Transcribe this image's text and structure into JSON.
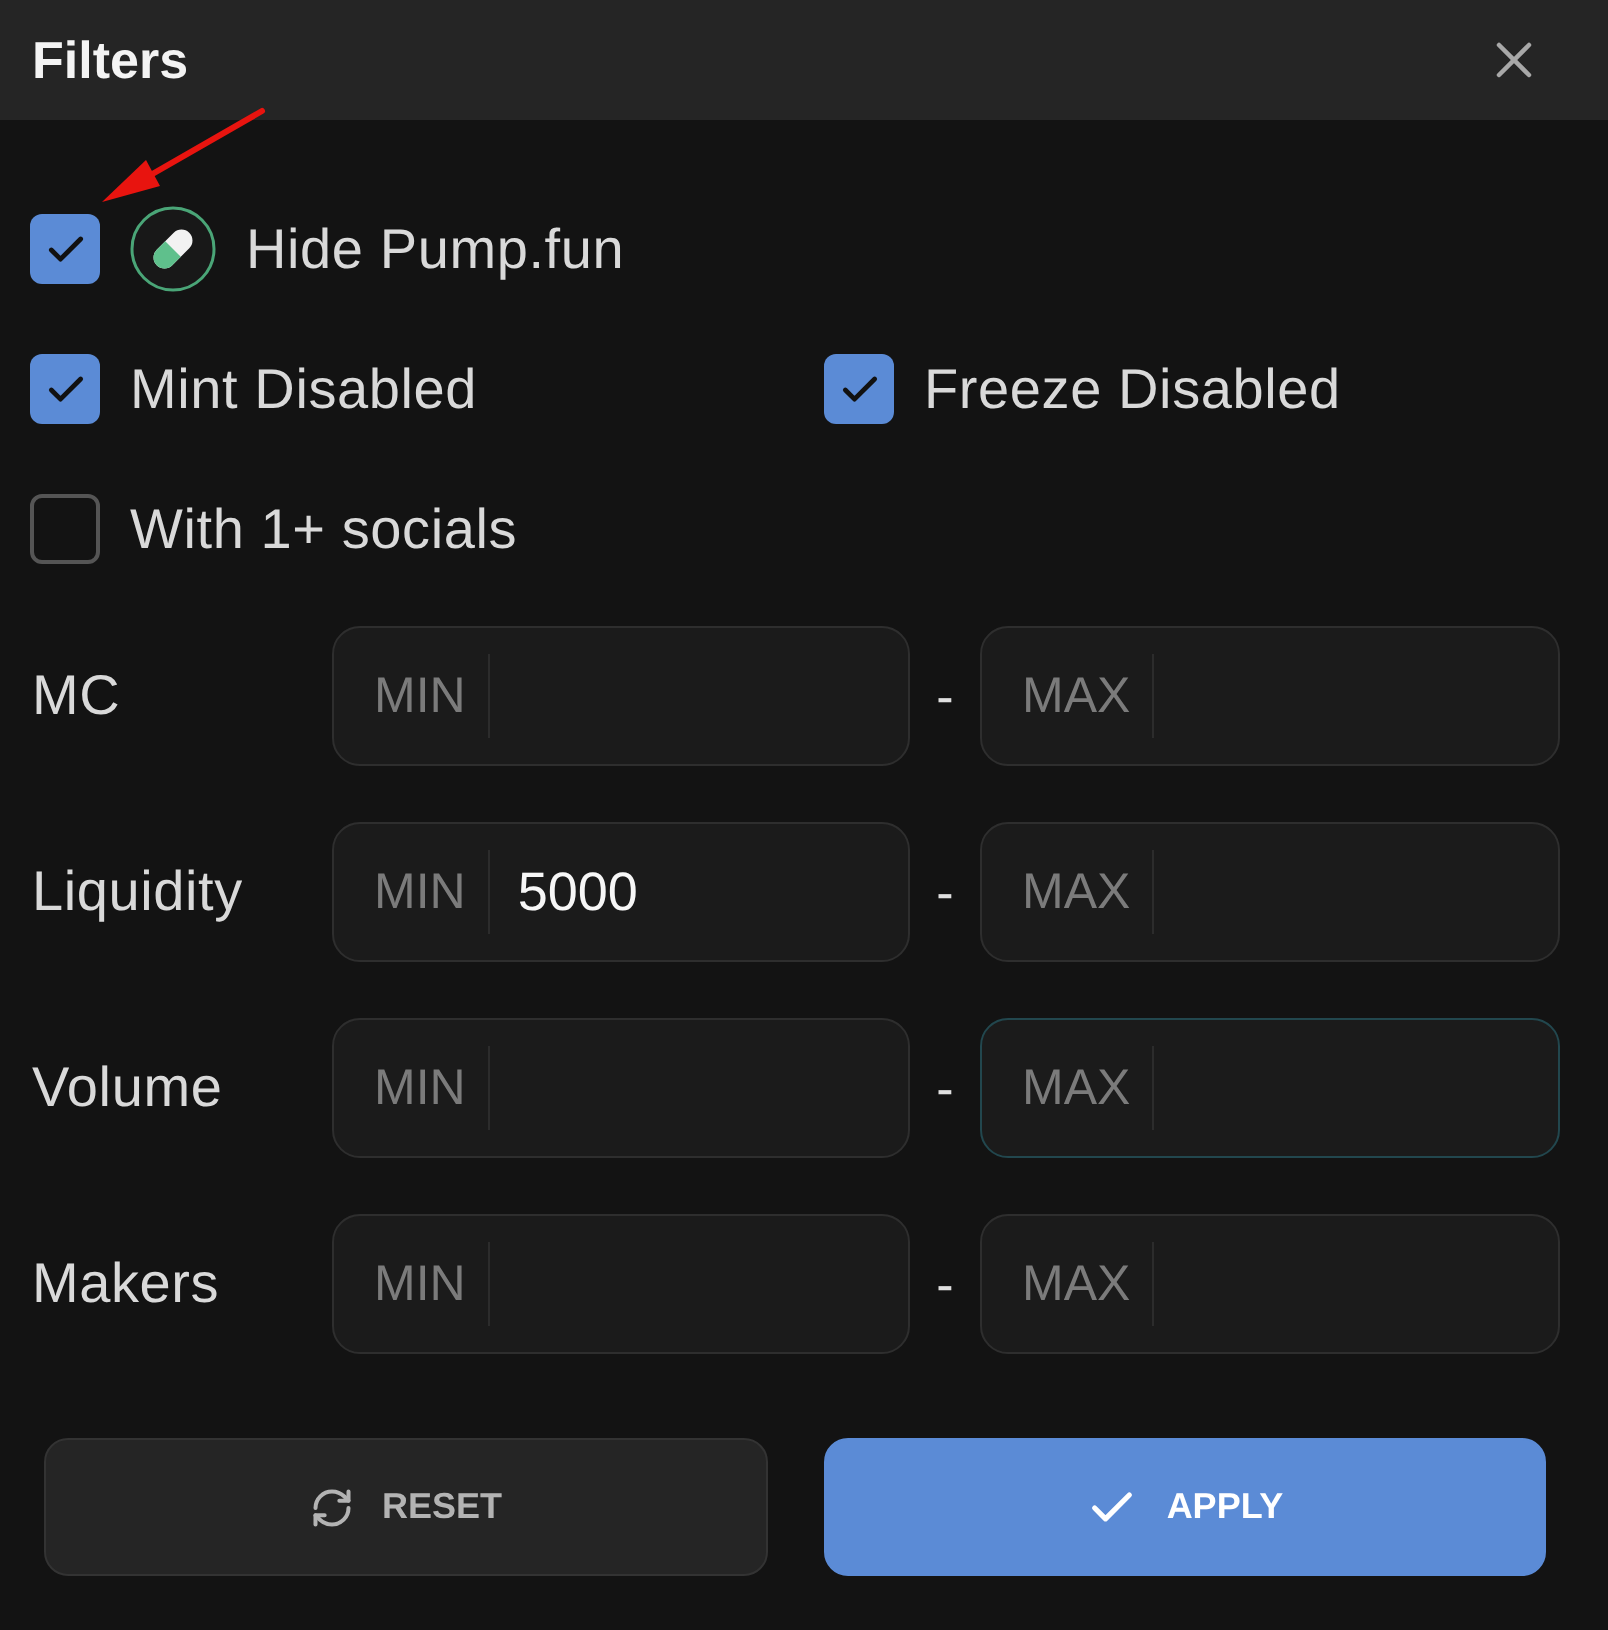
{
  "header": {
    "title": "Filters"
  },
  "checkbox_rows": [
    {
      "items": [
        {
          "kind": "badged",
          "label": "Hide Pump.fun",
          "checked": true
        }
      ]
    },
    {
      "items": [
        {
          "kind": "plain",
          "label": "Mint Disabled",
          "checked": true
        },
        {
          "kind": "plain",
          "label": "Freeze Disabled",
          "checked": true
        }
      ]
    },
    {
      "items": [
        {
          "kind": "plain",
          "label": "With 1+ socials",
          "checked": false
        }
      ]
    }
  ],
  "ranges": [
    {
      "label": "MC",
      "min": {
        "prefix": "MIN",
        "focused": false
      },
      "separator": "-",
      "max": {
        "prefix": "MAX",
        "focused": false
      }
    },
    {
      "label": "Liquidity",
      "min": {
        "prefix": "MIN",
        "value": "5000",
        "focused": false
      },
      "separator": "-",
      "max": {
        "prefix": "MAX",
        "focused": false
      }
    },
    {
      "label": "Volume",
      "min": {
        "prefix": "MIN",
        "focused": false
      },
      "separator": "-",
      "max": {
        "prefix": "MAX",
        "focused": true
      }
    },
    {
      "label": "Makers",
      "min": {
        "prefix": "MIN",
        "focused": false
      },
      "separator": "-",
      "max": {
        "prefix": "MAX",
        "focused": false
      }
    }
  ],
  "buttons": [
    {
      "kind": "reset",
      "label": "RESET"
    },
    {
      "kind": "apply",
      "label": "APPLY"
    }
  ],
  "annotations": [
    {
      "kind": "arrow"
    }
  ]
}
